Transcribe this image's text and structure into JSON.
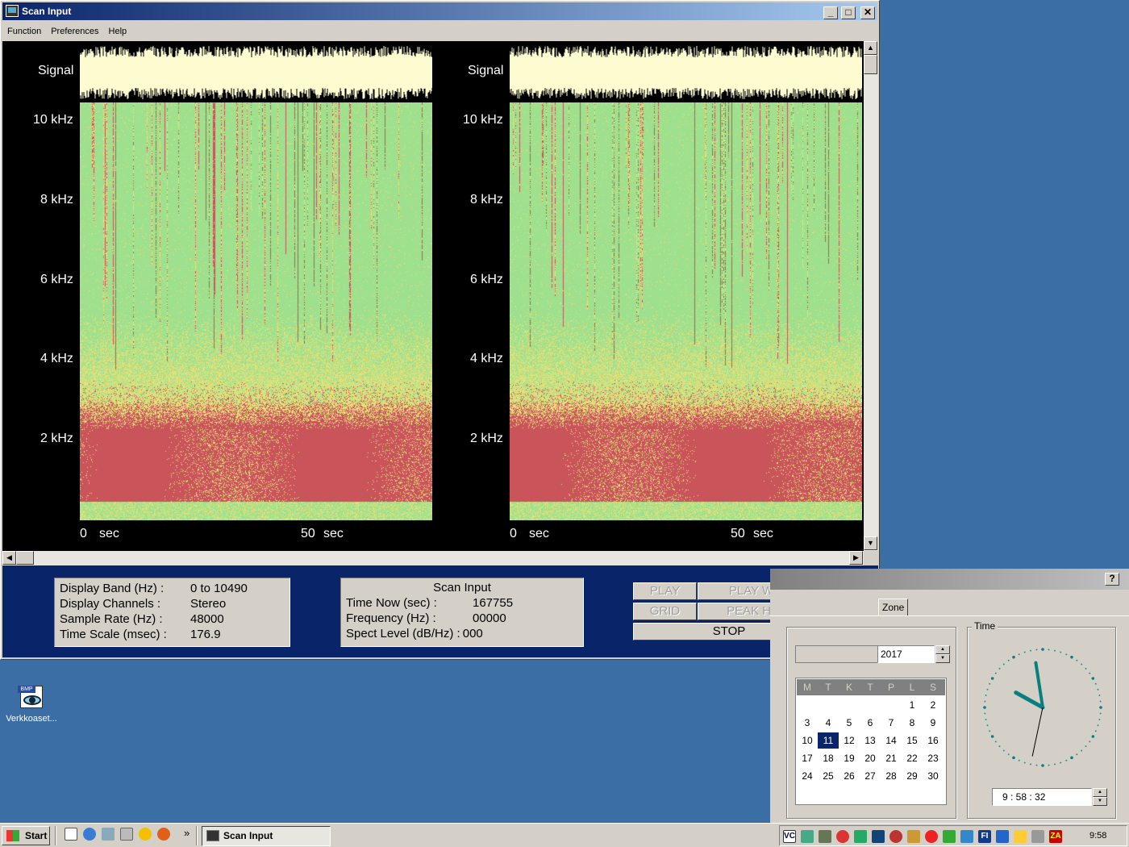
{
  "window": {
    "title": "Scan Input",
    "menu": [
      "Function",
      "Preferences",
      "Help"
    ]
  },
  "panels": [
    {
      "signal_label": "Signal",
      "freq_labels": [
        "10 kHz",
        "8 kHz",
        "6 kHz",
        "4 kHz",
        "2 kHz"
      ],
      "time_labels": [
        {
          "num": "0",
          "unit": "sec"
        },
        {
          "num": "50",
          "unit": "sec"
        }
      ]
    },
    {
      "signal_label": "Signal",
      "freq_labels": [
        "10 kHz",
        "8 kHz",
        "6 kHz",
        "4 kHz",
        "2 kHz"
      ],
      "time_labels": [
        {
          "num": "0",
          "unit": "sec"
        },
        {
          "num": "50",
          "unit": "sec"
        }
      ]
    }
  ],
  "display_info": [
    {
      "label": "Display Band (Hz) :",
      "value": "0 to 10490"
    },
    {
      "label": "Display Channels :",
      "value": "Stereo"
    },
    {
      "label": "Sample Rate (Hz) :",
      "value": "48000"
    },
    {
      "label": "Time Scale (msec) :",
      "value": "176.9"
    }
  ],
  "scan_info": {
    "title": "Scan Input",
    "rows": [
      {
        "label": "Time Now (sec) :",
        "value": "167755"
      },
      {
        "label": "Frequency (Hz) :",
        "value": "00000"
      },
      {
        "label": "Spect Level (dB/Hz) :",
        "value": "000"
      }
    ]
  },
  "controls": {
    "play": "PLAY",
    "play_wdw": "PLAY WDW",
    "grid": "GRID",
    "peak_hold": "PEAK HOLD",
    "stop": "STOP"
  },
  "desktop_icon": {
    "label": "Verkkoaset...",
    "badge": "BMP"
  },
  "datetime": {
    "help": "?",
    "tab_partial": "Zone",
    "year": "2017",
    "weekdays": [
      "M",
      "T",
      "K",
      "T",
      "P",
      "L",
      "S"
    ],
    "weeks": [
      [
        "",
        "",
        "",
        "",
        "",
        "1",
        "2"
      ],
      [
        "3",
        "4",
        "5",
        "6",
        "7",
        "8",
        "9"
      ],
      [
        "10",
        "11",
        "12",
        "13",
        "14",
        "15",
        "16"
      ],
      [
        "17",
        "18",
        "19",
        "20",
        "21",
        "22",
        "23"
      ],
      [
        "24",
        "25",
        "26",
        "27",
        "28",
        "29",
        "30"
      ]
    ],
    "selected_day": "11",
    "time_group_label": "Time",
    "time_value": "9 : 58 : 32",
    "clock": {
      "hour": 9,
      "minute": 58,
      "second": 32
    }
  },
  "taskbar": {
    "start": "Start",
    "task": "Scan Input",
    "chevron": "»",
    "tray_text": [
      "VC",
      "FI",
      "ZA"
    ],
    "clock": "9:58"
  },
  "colors": {
    "spectrogram_low": "#c9545a",
    "spectrogram_mid": "#e4e07a",
    "spectrogram_high": "#9ee08e",
    "signal": "#fdfcd0",
    "panel_bg": "#0a246a",
    "desktop": "#3a6ea5"
  }
}
